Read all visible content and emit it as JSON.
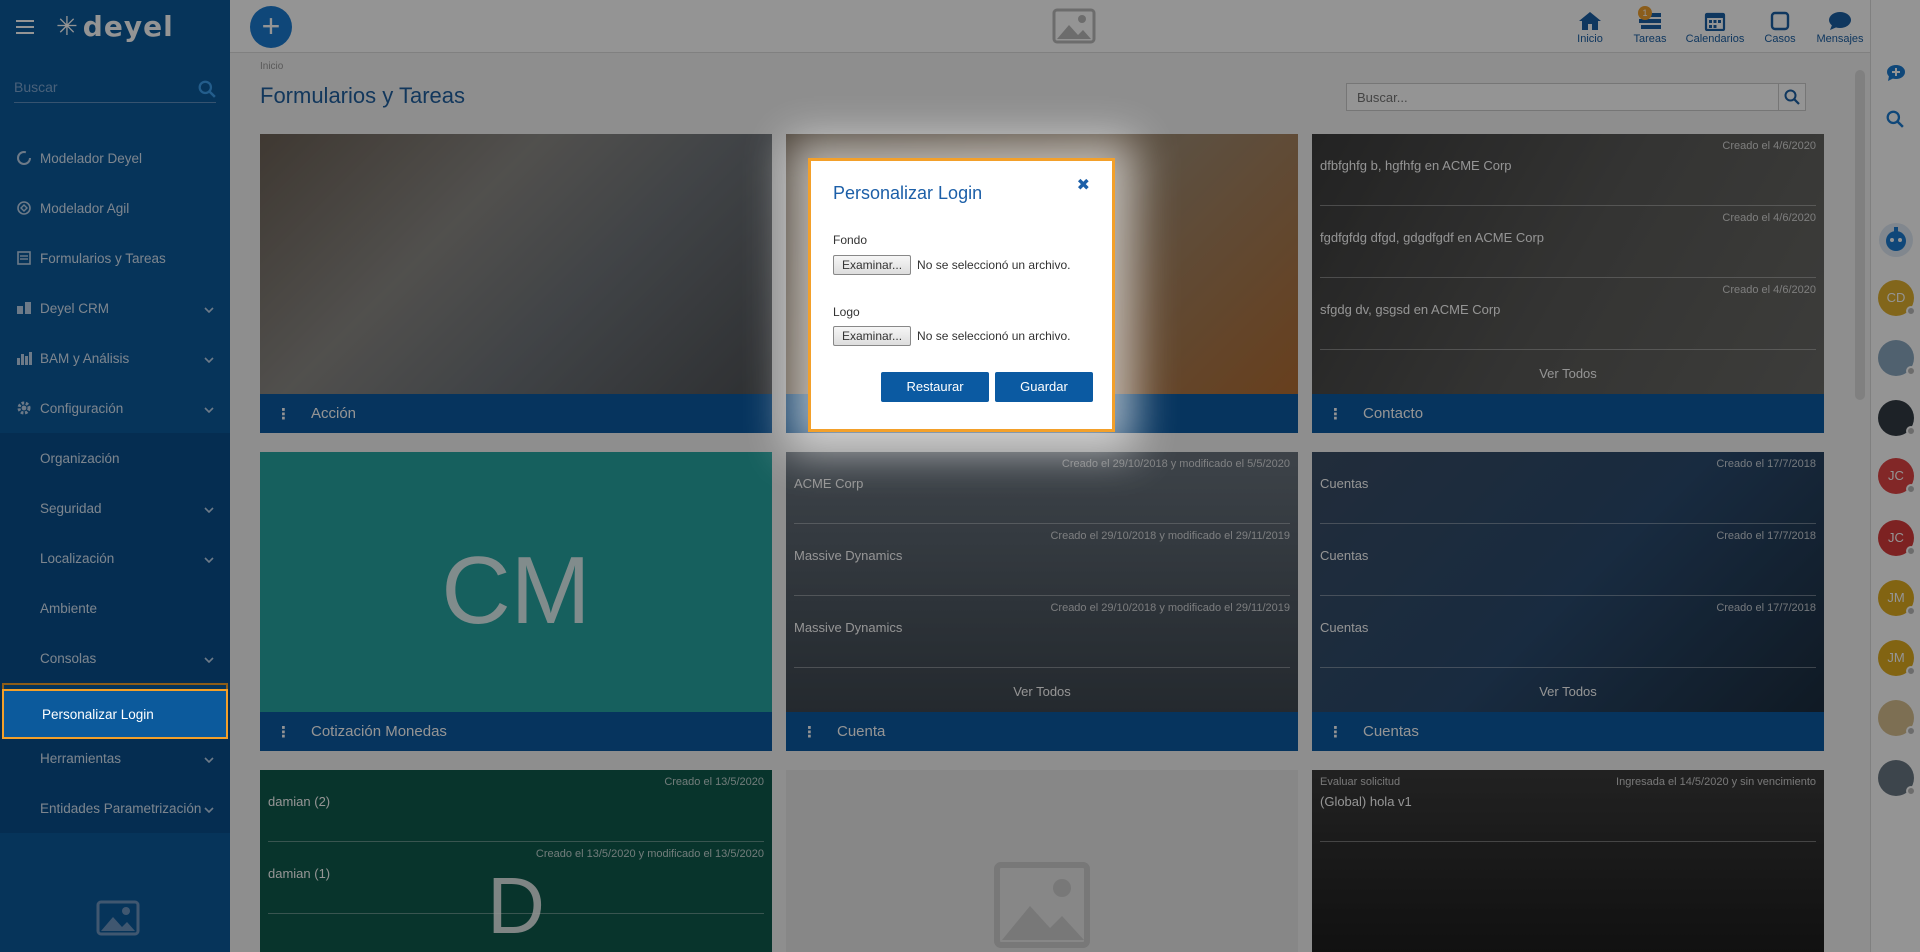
{
  "app": {
    "logo_text": "deyel"
  },
  "sidebar": {
    "search_placeholder": "Buscar",
    "items": [
      {
        "label": "Modelador Deyel",
        "icon": "modeler-icon"
      },
      {
        "label": "Modelador Agil",
        "icon": "agile-icon"
      },
      {
        "label": "Formularios y Tareas",
        "icon": "forms-icon"
      },
      {
        "label": "Deyel CRM",
        "icon": "crm-icon"
      },
      {
        "label": "BAM y Análisis",
        "icon": "chart-icon"
      },
      {
        "label": "Configuración",
        "icon": "gear-icon"
      }
    ],
    "sub_items": [
      {
        "label": "Organización"
      },
      {
        "label": "Seguridad"
      },
      {
        "label": "Localización"
      },
      {
        "label": "Ambiente"
      },
      {
        "label": "Consolas"
      },
      {
        "label": "Personalizar Login"
      },
      {
        "label": "Herramientas"
      },
      {
        "label": "Entidades Parametrización"
      }
    ]
  },
  "topnav": {
    "items": [
      {
        "label": "Inicio"
      },
      {
        "label": "Tareas",
        "badge": "1"
      },
      {
        "label": "Calendarios"
      },
      {
        "label": "Casos"
      },
      {
        "label": "Mensajes"
      }
    ]
  },
  "rail": {
    "avatars": [
      {
        "initials": "CD",
        "color": "#e0b030"
      },
      {
        "initials": "",
        "color": "#8aa8c0"
      },
      {
        "initials": "",
        "color": "#333c44"
      },
      {
        "initials": "JC",
        "color": "#e04444"
      },
      {
        "initials": "JC",
        "color": "#d83c3c"
      },
      {
        "initials": "JM",
        "color": "#e0ac20"
      },
      {
        "initials": "JM",
        "color": "#e0ac20"
      },
      {
        "initials": "",
        "color": "#d8c090"
      },
      {
        "initials": "",
        "color": "#6a7884"
      }
    ]
  },
  "main": {
    "breadcrumb": "Inicio",
    "title": "Formularios y Tareas",
    "search_placeholder": "Buscar...",
    "cards": [
      {
        "footer": "Acción",
        "bg": "#5a5f66"
      },
      {
        "footer": "",
        "bg": "#8c7a62"
      },
      {
        "footer": "Contacto",
        "bg": "#4a4a4a",
        "rows": [
          {
            "meta": "Creado el 4/6/2020",
            "text": "dfbfghfg b, hgfhfg en ACME Corp"
          },
          {
            "meta": "Creado el 4/6/2020",
            "text": "fgdfgfdg dfgd, gdgdfgdf en ACME Corp"
          },
          {
            "meta": "Creado el 4/6/2020",
            "text": "sfgdg dv, gsgsd en ACME Corp"
          }
        ],
        "more": "Ver Todos"
      },
      {
        "footer": "Cotización Monedas",
        "bg": "#27a6a2",
        "letter": "CM"
      },
      {
        "footer": "Cuenta",
        "bg": "#4c5660",
        "rows": [
          {
            "meta": "Creado el 29/10/2018 y modificado el 5/5/2020",
            "text": "ACME Corp"
          },
          {
            "meta": "Creado el 29/10/2018 y modificado el 29/11/2019",
            "text": "Massive Dynamics"
          },
          {
            "meta": "Creado el 29/10/2018 y modificado el 29/11/2019",
            "text": "Massive Dynamics"
          }
        ],
        "more": "Ver Todos"
      },
      {
        "footer": "Cuentas",
        "bg": "#2e4258",
        "rows": [
          {
            "meta": "Creado el 17/7/2018",
            "text": "Cuentas"
          },
          {
            "meta": "Creado el 17/7/2018",
            "text": "Cuentas"
          },
          {
            "meta": "Creado el 17/7/2018",
            "text": "Cuentas"
          }
        ],
        "more": "Ver Todos"
      },
      {
        "footer": "",
        "bg": "#0f5a4c",
        "letter": "D",
        "rows": [
          {
            "meta": "Creado el 13/5/2020",
            "text": "damian (2)"
          },
          {
            "meta": "Creado el 13/5/2020 y modificado el 13/5/2020",
            "text": "damian (1)"
          }
        ]
      },
      {
        "footer": "",
        "bg": "#e8e8e8"
      },
      {
        "footer": "",
        "bg": "#2c2c2c",
        "rows": [
          {
            "meta": "Ingresada el 14/5/2020 y sin vencimiento",
            "text": "(Global) hola v1",
            "left_meta": "Evaluar solicitud"
          }
        ]
      }
    ]
  },
  "modal": {
    "title": "Personalizar Login",
    "fondo_label": "Fondo",
    "logo_label": "Logo",
    "browse_label": "Examinar...",
    "no_file": "No se seleccionó un archivo.",
    "restore_label": "Restaurar",
    "save_label": "Guardar"
  }
}
